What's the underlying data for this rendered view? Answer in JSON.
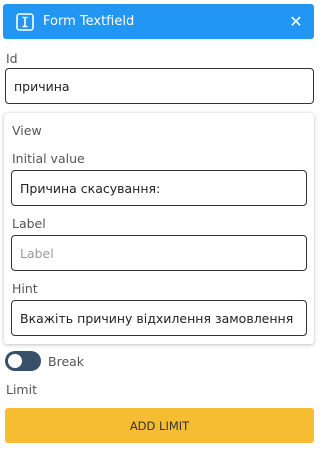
{
  "header": {
    "title": "Form Textfield",
    "icon": "text-cursor-icon",
    "close_icon": "close-icon",
    "accent_color": "#2196f3"
  },
  "id_field": {
    "label": "Id",
    "value": "причина"
  },
  "view_section": {
    "title": "View",
    "initial_value": {
      "label": "Initial value",
      "value": "Причина скасування:"
    },
    "label_field": {
      "label": "Label",
      "placeholder": "Label",
      "value": ""
    },
    "hint_field": {
      "label": "Hint",
      "value": "Вкажіть причину відхилення замовлення"
    }
  },
  "break_toggle": {
    "label": "Break",
    "enabled": false,
    "color": "#37516b"
  },
  "limit": {
    "label": "Limit",
    "add_button_label": "ADD LIMIT",
    "button_color": "#f7bd32"
  }
}
